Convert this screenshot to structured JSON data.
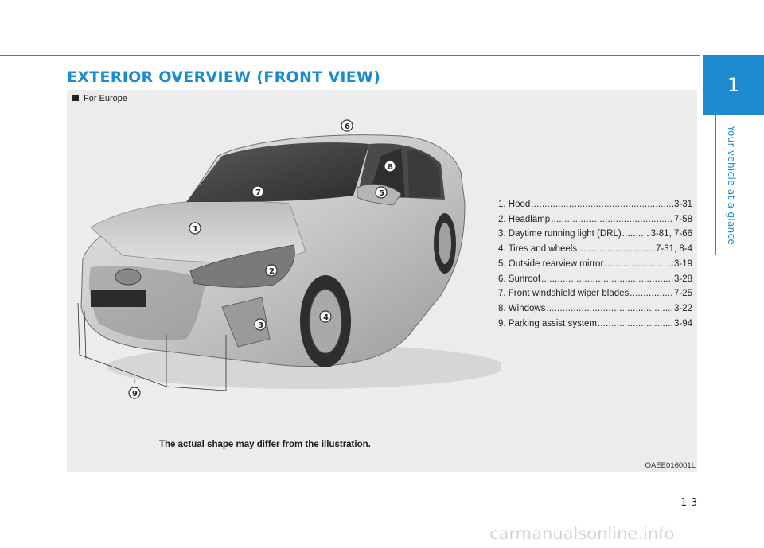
{
  "header": {
    "title": "EXTERIOR OVERVIEW (FRONT VIEW)"
  },
  "side_tab": {
    "chapter_number": "1",
    "chapter_label": "Your vehicle at a glance"
  },
  "figure": {
    "region_note": "For Europe",
    "callouts": [
      "1",
      "2",
      "3",
      "4",
      "5",
      "6",
      "7",
      "8",
      "9"
    ],
    "disclaimer": "The actual shape may differ from the illustration.",
    "image_code": "OAEE016001L"
  },
  "parts": [
    {
      "label": "1. Hood",
      "page": "3-31"
    },
    {
      "label": "2. Headlamp",
      "page": "7-58"
    },
    {
      "label": "3. Daytime running light (DRL)",
      "page": "3-81, 7-66"
    },
    {
      "label": "4. Tires and wheels",
      "page": "7-31, 8-4"
    },
    {
      "label": "5. Outside rearview mirror",
      "page": "3-19"
    },
    {
      "label": "6. Sunroof",
      "page": "3-28"
    },
    {
      "label": "7. Front windshield wiper blades",
      "page": "7-25"
    },
    {
      "label": "8. Windows",
      "page": "3-22"
    },
    {
      "label": "9. Parking assist system",
      "page": "3-94"
    }
  ],
  "footer": {
    "page_number": "1-3",
    "watermark": "carmanualsonline.info"
  }
}
